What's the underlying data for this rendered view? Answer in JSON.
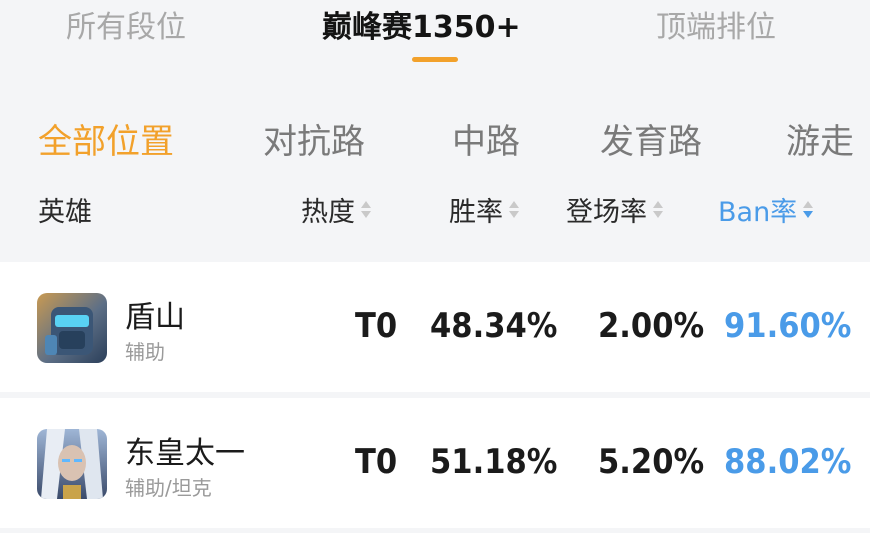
{
  "top_tabs": [
    {
      "label": "所有段位"
    },
    {
      "label": "巅峰赛1350+"
    },
    {
      "label": "顶端排位"
    }
  ],
  "position_tabs": [
    {
      "label": "全部位置"
    },
    {
      "label": "对抗路"
    },
    {
      "label": "中路"
    },
    {
      "label": "发育路"
    },
    {
      "label": "游走"
    }
  ],
  "table": {
    "columns": {
      "hero": "英雄",
      "heat": "热度",
      "win_rate": "胜率",
      "pick_rate": "登场率",
      "ban_rate": "Ban率"
    },
    "rows": [
      {
        "name": "盾山",
        "role": "辅助",
        "heat": "T0",
        "win_rate": "48.34%",
        "pick_rate": "2.00%",
        "ban_rate": "91.60%",
        "avatar_icon": "hero-portrait-icon"
      },
      {
        "name": "东皇太一",
        "role": "辅助/坦克",
        "heat": "T0",
        "win_rate": "51.18%",
        "pick_rate": "5.20%",
        "ban_rate": "88.02%",
        "avatar_icon": "hero-portrait-icon"
      }
    ]
  },
  "colors": {
    "accent": "#f2a12b",
    "ban_blue": "#4a9be8",
    "background": "#f4f5f7"
  }
}
